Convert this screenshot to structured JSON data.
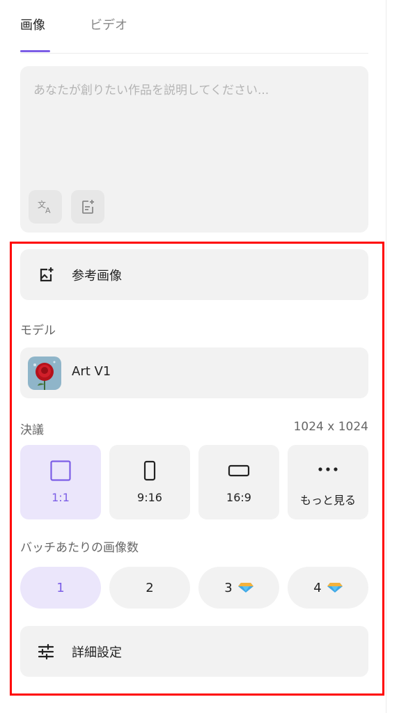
{
  "tabs": [
    {
      "label": "画像"
    },
    {
      "label": "ビデオ"
    }
  ],
  "prompt": {
    "placeholder": "あなたが創りたい作品を説明してください..."
  },
  "reference_image": {
    "label": "参考画像"
  },
  "model_section": {
    "label": "モデル",
    "selected_model": "Art V1"
  },
  "resolution": {
    "label": "決議",
    "value": "1024 x 1024",
    "options": [
      {
        "label": "1:1",
        "selected": true
      },
      {
        "label": "9:16",
        "selected": false
      },
      {
        "label": "16:9",
        "selected": false
      },
      {
        "label": "もっと見る",
        "selected": false
      }
    ]
  },
  "batch": {
    "label": "バッチあたりの画像数",
    "options": [
      {
        "label": "1",
        "selected": true,
        "premium": false
      },
      {
        "label": "2",
        "selected": false,
        "premium": false
      },
      {
        "label": "3",
        "selected": false,
        "premium": true
      },
      {
        "label": "4",
        "selected": false,
        "premium": true
      }
    ]
  },
  "advanced": {
    "label": "詳細設定"
  },
  "colors": {
    "accent": "#7c5ee6",
    "highlight": "#ff0000",
    "surface": "#f2f2f2",
    "selected_bg": "#ebe6fb"
  }
}
